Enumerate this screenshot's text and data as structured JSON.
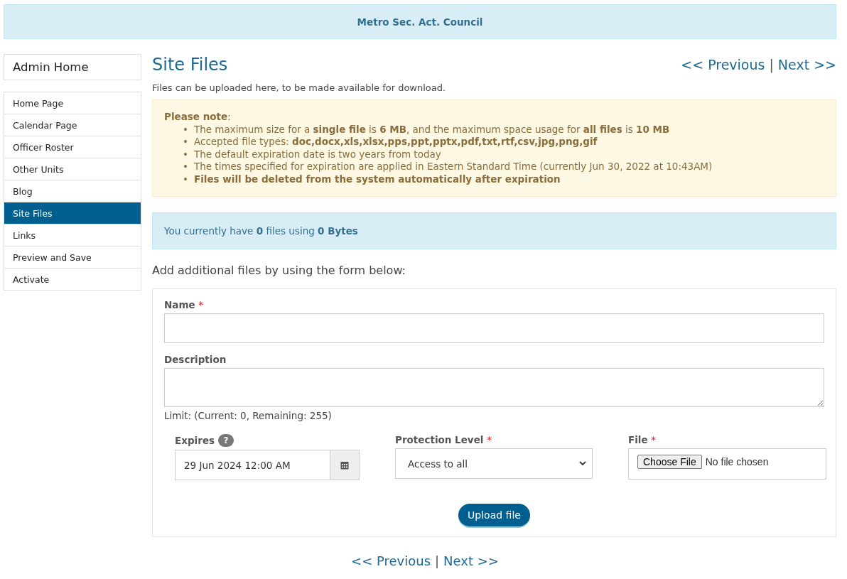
{
  "banner": {
    "title": "Metro Sec. Act. Council"
  },
  "sidebar": {
    "home": "Admin Home",
    "items": [
      {
        "label": "Home Page",
        "selected": false
      },
      {
        "label": "Calendar Page",
        "selected": false
      },
      {
        "label": "Officer Roster",
        "selected": false
      },
      {
        "label": "Other Units",
        "selected": false
      },
      {
        "label": "Blog",
        "selected": false
      },
      {
        "label": "Site Files",
        "selected": true
      },
      {
        "label": "Links",
        "selected": false
      },
      {
        "label": "Preview and Save",
        "selected": false
      },
      {
        "label": "Activate",
        "selected": false
      }
    ]
  },
  "page": {
    "title": "Site Files",
    "intro": "Files can be uploaded here, to be made available for download."
  },
  "pager_top": {
    "previous": "<< Previous",
    "separator": "|",
    "next": "Next >>"
  },
  "note": {
    "heading": "**Please note**:",
    "marker": "•",
    "items": [
      "The maximum size for a **single file** is **6 MB**, and the maximum space usage for **all files** is **10 MB**",
      "Accepted file types: **doc,docx,xls,xlsx,pps,ppt,pptx,pdf,txt,rtf,csv,jpg,png,gif**",
      "The default expiration date is two years from today",
      "The times specified for expiration are applied in Eastern Standard Time (currently Jun 30, 2022 at 10:43AM)",
      "**Files will be deleted from the system automatically after expiration**"
    ]
  },
  "usage": "You currently have **0** files using **0 Bytes**",
  "form_heading": "Add additional files by using the form below:",
  "form": {
    "name": {
      "label": "Name",
      "required_mark": "*"
    },
    "description": {
      "label": "Description",
      "limit": "Limit: (Current: 0, Remaining: 255)"
    },
    "expires": {
      "label": "Expires",
      "help": "?",
      "value": "29 Jun 2024 12:00 AM"
    },
    "protection": {
      "label": "Protection Level",
      "required_mark": "*",
      "value": "Access to all"
    },
    "file": {
      "label": "File",
      "required_mark": "*",
      "button": "Choose File",
      "status": "No file chosen"
    },
    "submit": "Upload file"
  },
  "pager_bottom": {
    "previous": "<< Previous",
    "separator": "|",
    "next": "Next >>"
  }
}
